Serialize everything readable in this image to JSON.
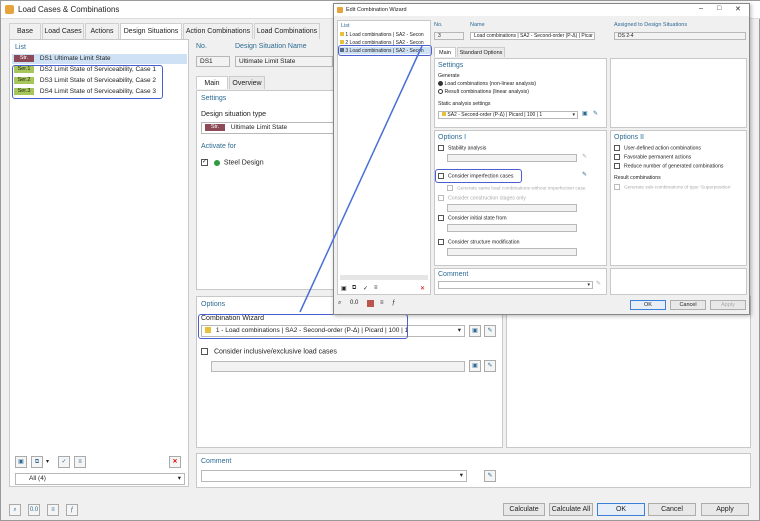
{
  "window": {
    "title": "Load Cases & Combinations"
  },
  "tabs": [
    "Base",
    "Load Cases",
    "Actions",
    "Design Situations",
    "Action Combinations",
    "Load Combinations"
  ],
  "active_tab": "Design Situations",
  "list": {
    "label": "List",
    "items": [
      {
        "badge": "Str.",
        "badge_color": "#8b4a56",
        "id": "DS1",
        "name": "Ultimate Limit State"
      },
      {
        "badge": "Ser.1",
        "badge_color": "#a6c65a",
        "id": "DS2",
        "name": "Limit State of Serviceability, Case 1"
      },
      {
        "badge": "Ser.2",
        "badge_color": "#a6c65a",
        "id": "DS3",
        "name": "Limit State of Serviceability, Case 2"
      },
      {
        "badge": "Ser.3",
        "badge_color": "#a6c65a",
        "id": "DS4",
        "name": "Limit State of Serviceability, Case 3"
      }
    ],
    "filter": "All (4)"
  },
  "detail": {
    "no_label": "No.",
    "no_value": "DS1",
    "name_label": "Design Situation Name",
    "name_value": "Ultimate Limit State",
    "subtabs": [
      "Main",
      "Overview"
    ],
    "settings_label": "Settings",
    "dst_label": "Design situation type",
    "dst_badge": "Str.",
    "dst_value": "Ultimate Limit State",
    "activate_label": "Activate for",
    "activate_item": "Steel Design",
    "options_label": "Options",
    "wizard_label": "Combination Wizard",
    "wizard_value": "1 - Load combinations | SA2 - Second-order (P-Δ) | Picard | 100 | 1",
    "inclusive_label": "Consider inclusive/exclusive load cases",
    "comment_label": "Comment"
  },
  "bottom_buttons": {
    "calculate": "Calculate",
    "calculate_all": "Calculate All",
    "ok": "OK",
    "cancel": "Cancel",
    "apply": "Apply"
  },
  "wizard": {
    "title": "Edit Combination Wizard",
    "list_label": "List",
    "list_items": [
      "1  Load combinations | SA2 - Secon",
      "2  Load combinations | SA2 - Secon",
      "3  Load combinations | SA2 - Secon"
    ],
    "no_label": "No.",
    "no_value": "3",
    "name_label": "Name",
    "name_value": "Load combinations | SA2 - Second-order (P-Δ) | Picar",
    "assigned_label": "Assigned to Design Situations",
    "assigned_value": "DS 2-4",
    "subtabs": [
      "Main",
      "Standard Options"
    ],
    "settings_label": "Settings",
    "generate_label": "Generate",
    "radio1": "Load combinations (non-linear analysis)",
    "radio2": "Result combinations (linear analysis)",
    "static_label": "Static analysis settings",
    "static_value": "SA2 - Second-order (P-Δ) | Picard | 100 | 1",
    "options1_label": "Options I",
    "options2_label": "Options II",
    "stability": "Stability analysis",
    "imperfection": "Consider imperfection cases",
    "generate_same": "Generate same load combinations without imperfection case",
    "construction": "Consider construction stages only",
    "initial": "Consider initial state from",
    "modification": "Consider structure modification",
    "user_defined": "User-defined action combinations",
    "favorable": "Favorable permanent actions",
    "reduce": "Reduce number of generated combinations",
    "result_comb": "Result combinations",
    "generate_sub": "Generate sub-combinations of type 'Superposition'",
    "comment_label": "Comment",
    "ok": "OK",
    "cancel": "Cancel",
    "apply": "Apply"
  }
}
